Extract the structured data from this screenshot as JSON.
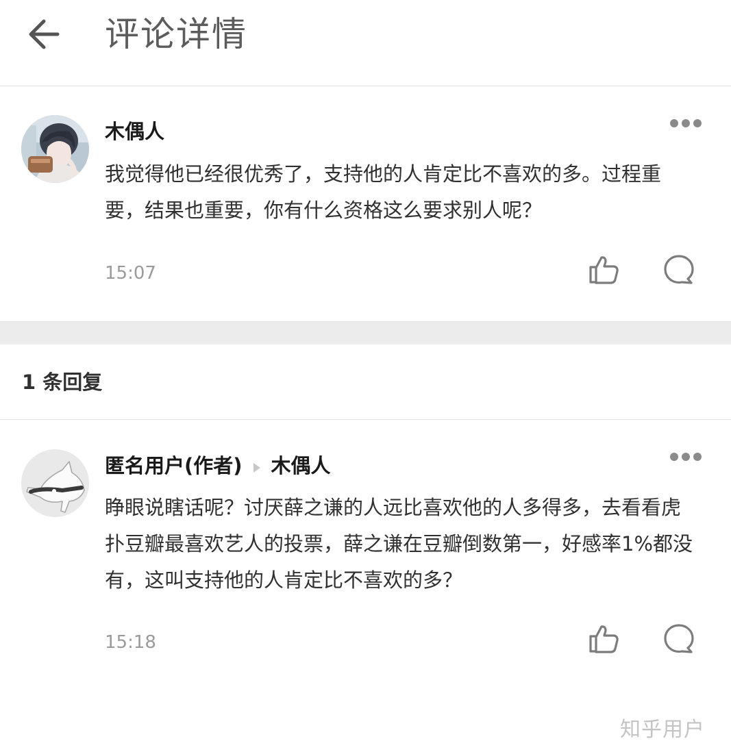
{
  "header": {
    "title": "评论详情",
    "back_icon": "arrow-left-icon"
  },
  "comment": {
    "author": "木偶人",
    "text": "我觉得他已经很优秀了，支持他的人肯定比不喜欢的多。过程重要，结果也重要，你有什么资格这么要求别人呢？",
    "time": "15:07",
    "avatar": "user-avatar-photo",
    "icons": [
      "more-icon",
      "thumbs-up-icon",
      "comment-bubble-icon"
    ]
  },
  "replies_section": {
    "count_label": "1 条回复",
    "items": [
      {
        "author": "匿名用户(作者)",
        "reply_to": "木偶人",
        "text": "睁眼说瞎话呢？讨厌薛之谦的人远比喜欢他的人多得多，去看看虎扑豆瓣最喜欢艺人的投票，薛之谦在豆瓣倒数第一，好感率1%都没有，这叫支持他的人肯定比不喜欢的多？",
        "time": "15:18",
        "avatar": "anonymous-avatar",
        "icons": [
          "more-icon",
          "thumbs-up-icon",
          "comment-bubble-icon"
        ]
      }
    ]
  },
  "watermark": "知乎用户",
  "colors": {
    "divider": "#e2e2e2",
    "band": "#ececec",
    "icon": "#8a8a8a",
    "time": "#9a9a9a"
  }
}
